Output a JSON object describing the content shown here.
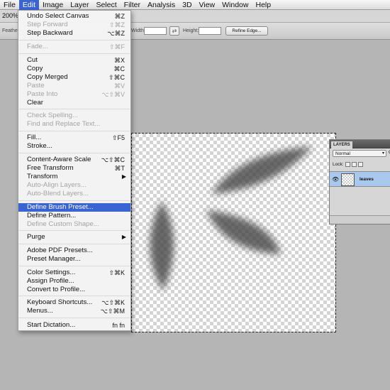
{
  "menubar": {
    "items": [
      "File",
      "Edit",
      "Image",
      "Layer",
      "Select",
      "Filter",
      "Analysis",
      "3D",
      "View",
      "Window",
      "Help"
    ],
    "active": "Edit"
  },
  "options": {
    "zoom": "200%",
    "feather_label": "Feathe",
    "width_label": "Width:",
    "height_label": "Height:",
    "refine_edge_label": "Refine Edge..."
  },
  "edit_menu": {
    "items": [
      {
        "label": "Undo Select Canvas",
        "shortcut": "⌘Z",
        "enabled": true
      },
      {
        "label": "Step Forward",
        "shortcut": "⇧⌘Z",
        "enabled": false
      },
      {
        "label": "Step Backward",
        "shortcut": "⌥⌘Z",
        "enabled": true
      },
      {
        "label": "Fade...",
        "shortcut": "⇧⌘F",
        "enabled": false
      },
      {
        "label": "Cut",
        "shortcut": "⌘X",
        "enabled": true
      },
      {
        "label": "Copy",
        "shortcut": "⌘C",
        "enabled": true
      },
      {
        "label": "Copy Merged",
        "shortcut": "⇧⌘C",
        "enabled": true
      },
      {
        "label": "Paste",
        "shortcut": "⌘V",
        "enabled": false
      },
      {
        "label": "Paste Into",
        "shortcut": "⌥⇧⌘V",
        "enabled": false
      },
      {
        "label": "Clear",
        "shortcut": "",
        "enabled": true
      },
      {
        "label": "Check Spelling...",
        "shortcut": "",
        "enabled": false
      },
      {
        "label": "Find and Replace Text...",
        "shortcut": "",
        "enabled": false
      },
      {
        "label": "Fill...",
        "shortcut": "⇧F5",
        "enabled": true
      },
      {
        "label": "Stroke...",
        "shortcut": "",
        "enabled": true
      },
      {
        "label": "Content-Aware Scale",
        "shortcut": "⌥⇧⌘C",
        "enabled": true
      },
      {
        "label": "Free Transform",
        "shortcut": "⌘T",
        "enabled": true
      },
      {
        "label": "Transform",
        "shortcut": "",
        "enabled": true,
        "submenu": true
      },
      {
        "label": "Auto-Align Layers...",
        "shortcut": "",
        "enabled": false
      },
      {
        "label": "Auto-Blend Layers...",
        "shortcut": "",
        "enabled": false
      },
      {
        "label": "Define Brush Preset...",
        "shortcut": "",
        "enabled": true,
        "highlighted": true
      },
      {
        "label": "Define Pattern...",
        "shortcut": "",
        "enabled": true
      },
      {
        "label": "Define Custom Shape...",
        "shortcut": "",
        "enabled": false
      },
      {
        "label": "Purge",
        "shortcut": "",
        "enabled": true,
        "submenu": true
      },
      {
        "label": "Adobe PDF Presets...",
        "shortcut": "",
        "enabled": true
      },
      {
        "label": "Preset Manager...",
        "shortcut": "",
        "enabled": true
      },
      {
        "label": "Color Settings...",
        "shortcut": "⇧⌘K",
        "enabled": true
      },
      {
        "label": "Assign Profile...",
        "shortcut": "",
        "enabled": true
      },
      {
        "label": "Convert to Profile...",
        "shortcut": "",
        "enabled": true
      },
      {
        "label": "Keyboard Shortcuts...",
        "shortcut": "⌥⇧⌘K",
        "enabled": true
      },
      {
        "label": "Menus...",
        "shortcut": "⌥⇧⌘M",
        "enabled": true
      },
      {
        "label": "Start Dictation...",
        "shortcut": "fn fn",
        "enabled": true
      }
    ],
    "submenu_arrow": "▶"
  },
  "layers_panel": {
    "tab": "LAYERS",
    "blend_mode": "Normal",
    "opacity_label": "O",
    "lock_label": "Lock:",
    "layer_name": "leaves",
    "eye_icon": "👁"
  },
  "colors": {
    "highlight": "#3a63d4",
    "layer_selected": "#a9c8ee"
  }
}
